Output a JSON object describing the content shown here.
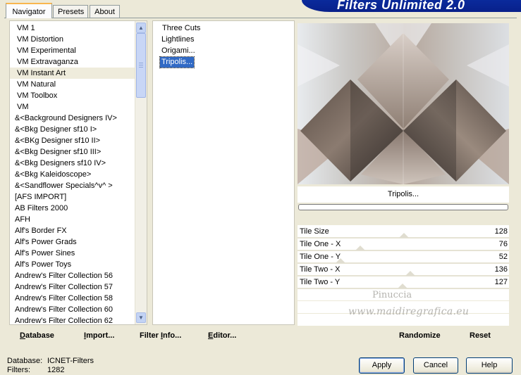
{
  "header": {
    "title": "Filters Unlimited 2.0"
  },
  "tabs": [
    {
      "label": "Navigator",
      "active": true
    },
    {
      "label": "Presets",
      "active": false
    },
    {
      "label": "About",
      "active": false
    }
  ],
  "categories": [
    "VM 1",
    "VM Distortion",
    "VM Experimental",
    "VM Extravaganza",
    "VM Instant Art",
    "VM Natural",
    "VM Toolbox",
    "VM",
    "&<Background Designers IV>",
    "&<Bkg Designer sf10 I>",
    "&<BKg Designer sf10 II>",
    "&<Bkg Designer sf10 III>",
    "&<Bkg Designers sf10 IV>",
    "&<Bkg Kaleidoscope>",
    "&<Sandflower Specials^v^ >",
    "[AFS IMPORT]",
    "AB Filters 2000",
    "AFH",
    "Alf's Border FX",
    "Alf's Power Grads",
    "Alf's Power Sines",
    "Alf's Power Toys",
    "Andrew's Filter Collection 56",
    "Andrew's Filter Collection 57",
    "Andrew's Filter Collection 58",
    "Andrew's Filter Collection 60",
    "Andrew's Filter Collection 62"
  ],
  "selected_category": "VM Instant Art",
  "filters": [
    "Three Cuts",
    "Lightlines",
    "Origami...",
    "Tripolis..."
  ],
  "selected_filter": "Tripolis...",
  "preview": {
    "filter_name": "Tripolis...",
    "progress": 0
  },
  "params": [
    {
      "label": "Tile Size",
      "value": "128",
      "level": 0.502
    },
    {
      "label": "Tile One - X",
      "value": "76",
      "level": 0.298
    },
    {
      "label": "Tile One - Y",
      "value": "52",
      "level": 0.204
    },
    {
      "label": "Tile Two - X",
      "value": "136",
      "level": 0.533
    },
    {
      "label": "Tile Two - Y",
      "value": "127",
      "level": 0.498
    }
  ],
  "watermark": {
    "line1": "Pinuccia",
    "line2": "www.maidiregrafica.eu"
  },
  "actions": {
    "database": "Database",
    "import": "Import...",
    "filter_info": "Filter Info...",
    "editor": "Editor...",
    "randomize": "Randomize",
    "reset": "Reset"
  },
  "info": {
    "database_label": "Database:",
    "database_value": "ICNET-Filters",
    "filters_label": "Filters:",
    "filters_value": "1282"
  },
  "dialog": {
    "apply": "Apply",
    "cancel": "Cancel",
    "help": "Help"
  },
  "colors": {
    "selection": "#316ac5",
    "banner": "#0a2a9c",
    "tab_accent": "#f9b64e",
    "face": "#ece9d8"
  }
}
